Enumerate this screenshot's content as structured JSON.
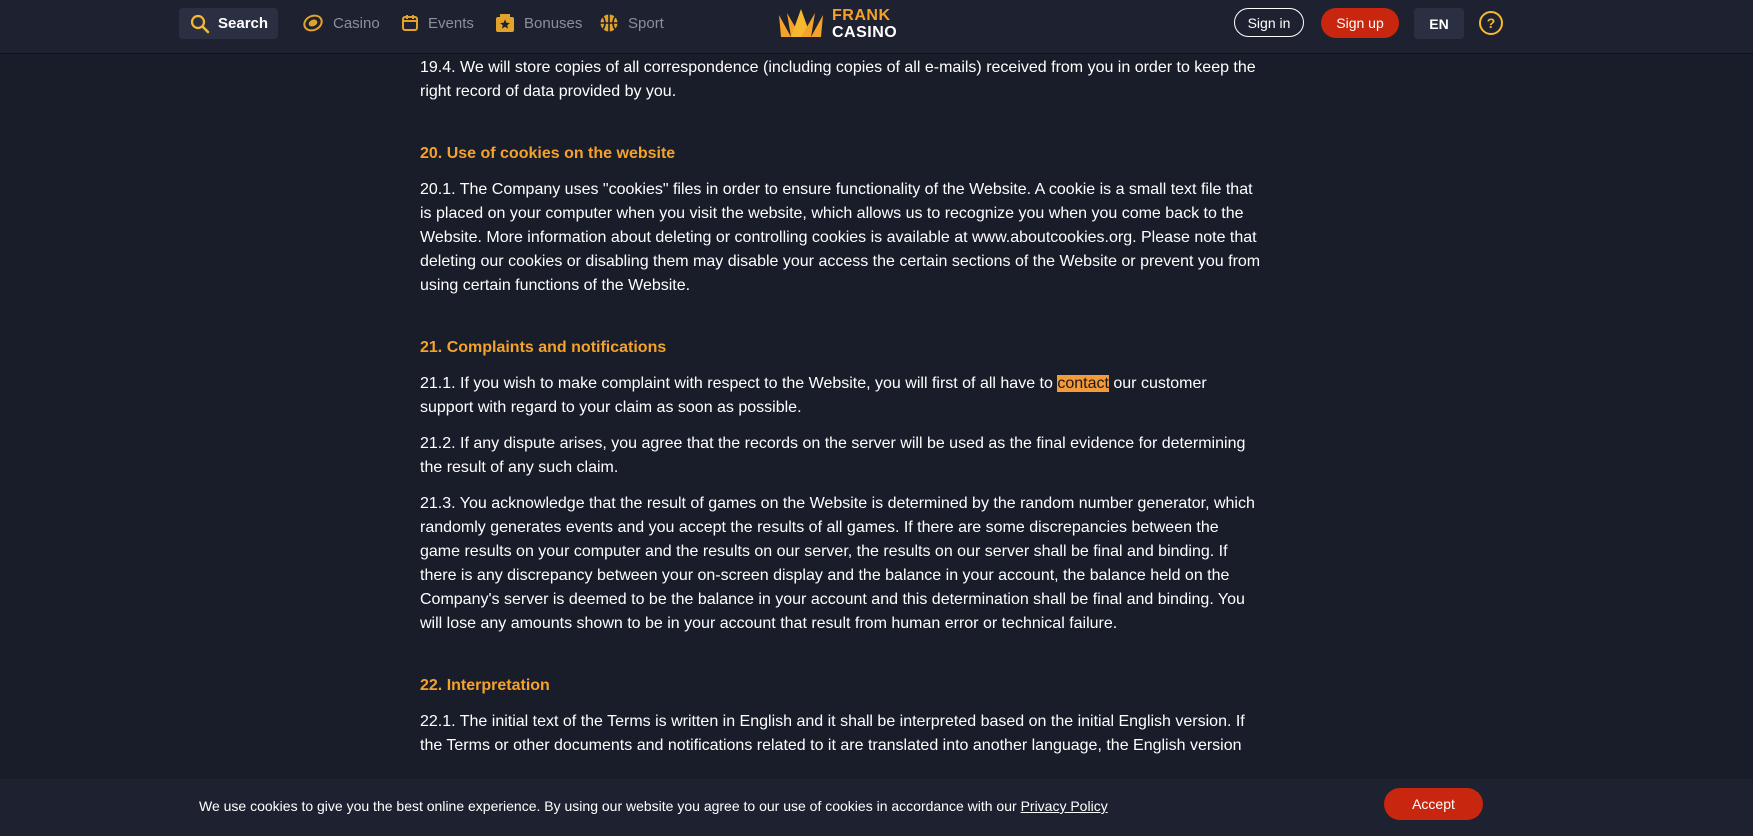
{
  "header": {
    "search_label": "Search",
    "nav": [
      {
        "label": "Casino",
        "icon": "casino-chip-icon"
      },
      {
        "label": "Events",
        "icon": "calendar-icon"
      },
      {
        "label": "Bonuses",
        "icon": "gift-star-icon"
      },
      {
        "label": "Sport",
        "icon": "basketball-icon"
      }
    ],
    "logo": {
      "line1": "FRANK",
      "line2": "CASINO"
    },
    "signin_label": "Sign in",
    "signup_label": "Sign up",
    "lang_label": "EN",
    "help_label": "?"
  },
  "colors": {
    "background": "#191d2a",
    "header": "#1e2230",
    "accent_orange": "#f5a22a",
    "brand_red": "#c8260f",
    "highlight": "#f59a3a"
  },
  "content": {
    "p_19_4": "19.4. We will store copies of all correspondence (including copies of all e-mails) received from you in order to keep the right record of data provided by you.",
    "h_20": "20. Use of cookies on the website",
    "p_20_1": "20.1. The Company uses \"cookies\" files in order to ensure functionality of the Website. A cookie is a small text file that is placed on your computer when you visit the website, which allows us to recognize you when you come back to the Website. More information about deleting or controlling cookies is available at www.aboutcookies.org. Please note that deleting our cookies or disabling them may disable your access the certain sections of the Website or prevent you from using certain functions of the Website.",
    "h_21": "21. Complaints and notifications",
    "p_21_1_before": "21.1. If you wish to make complaint with respect to the Website, you will first of all have to ",
    "p_21_1_highlight": "contact",
    "p_21_1_after": " our customer support with regard to your claim as soon as possible.",
    "p_21_2": "21.2. If any dispute arises, you agree that the records on the server will be used as the final evidence for determining the result of any such claim.",
    "p_21_3": "21.3. You acknowledge that the result of games on the Website is determined by the random number generator, which randomly generates events and you accept the results of all games. If there are some discrepancies between the game results on your computer and the results on our server, the results on our server shall be final and binding. If there is any discrepancy between your on-screen display and the balance in your account, the balance held on the Company's server is deemed to be the balance in your account and this determination shall be final and binding. You will lose any amounts shown to be in your account that result from human error or technical failure.",
    "h_22": "22. Interpretation",
    "p_22_1": "22.1. The initial text of the Terms is written in English and it shall be interpreted based on the initial English version. If the Terms or other documents and notifications related to it are translated into another language, the English version"
  },
  "cookie_bar": {
    "text": "We use cookies to give you the best online experience. By using our website you agree to our use of cookies in accordance with our ",
    "link_label": "Privacy Policy",
    "accept_label": "Accept"
  }
}
